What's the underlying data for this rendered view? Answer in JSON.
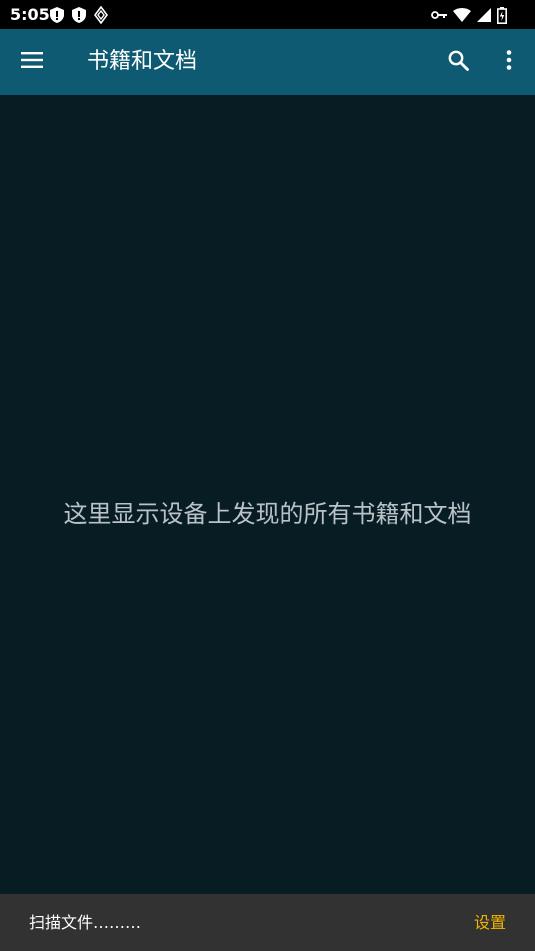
{
  "status_bar": {
    "time": "5:05",
    "left_icons": [
      "shield-icon",
      "shield-icon",
      "vpn-diamond-icon"
    ],
    "right_icons": [
      "key-icon",
      "wifi-icon",
      "signal-icon",
      "battery-icon"
    ]
  },
  "app_bar": {
    "title": "书籍和文档",
    "background_color": "#0d5a72",
    "icons": [
      "menu-icon",
      "search-icon",
      "more-vert-icon"
    ]
  },
  "main": {
    "empty_message": "这里显示设备上发现的所有书籍和文档",
    "background_color": "#081c24"
  },
  "snackbar": {
    "message": "扫描文件………",
    "action_label": "设置",
    "action_color": "#f0b400"
  }
}
